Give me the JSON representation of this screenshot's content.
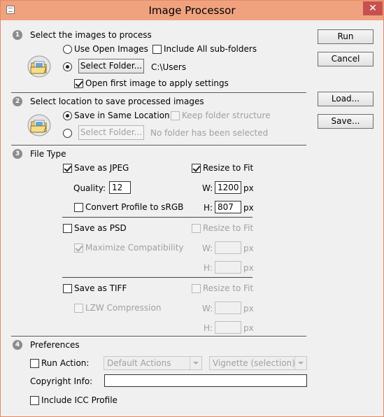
{
  "window": {
    "title": "Image Processor",
    "close_label": "✕"
  },
  "side_buttons": {
    "run": "Run",
    "cancel": "Cancel",
    "load": "Load...",
    "save": "Save..."
  },
  "section1": {
    "number": "1",
    "heading": "Select the images to process",
    "use_open_images": "Use Open Images",
    "include_subfolders": "Include All sub-folders",
    "select_folder": "Select Folder...",
    "folder_path": "C:\\Users",
    "open_first_image": "Open first image to apply settings"
  },
  "section2": {
    "number": "2",
    "heading": "Select location to save processed images",
    "save_same_location": "Save in Same Location",
    "keep_structure": "Keep folder structure",
    "select_folder": "Select Folder...",
    "no_folder": "No folder has been selected"
  },
  "section3": {
    "number": "3",
    "heading": "File Type",
    "jpeg": {
      "save_as": "Save as JPEG",
      "resize": "Resize to Fit",
      "quality_label": "Quality:",
      "quality_value": "12",
      "w_label": "W:",
      "w_value": "1200",
      "w_unit": "px",
      "h_label": "H:",
      "h_value": "807",
      "h_unit": "px",
      "convert_profile": "Convert Profile to sRGB"
    },
    "psd": {
      "save_as": "Save as PSD",
      "resize": "Resize to Fit",
      "maximize": "Maximize Compatibility",
      "w_label": "W:",
      "w_unit": "px",
      "h_label": "H:",
      "h_unit": "px"
    },
    "tiff": {
      "save_as": "Save as TIFF",
      "resize": "Resize to Fit",
      "lzw": "LZW Compression",
      "w_label": "W:",
      "w_unit": "px",
      "h_label": "H:",
      "h_unit": "px"
    }
  },
  "section4": {
    "number": "4",
    "heading": "Preferences",
    "run_action": "Run Action:",
    "action_set": "Default Actions",
    "action": "Vignette (selection)",
    "copyright_label": "Copyright Info:",
    "copyright_value": "",
    "include_icc": "Include ICC Profile"
  }
}
